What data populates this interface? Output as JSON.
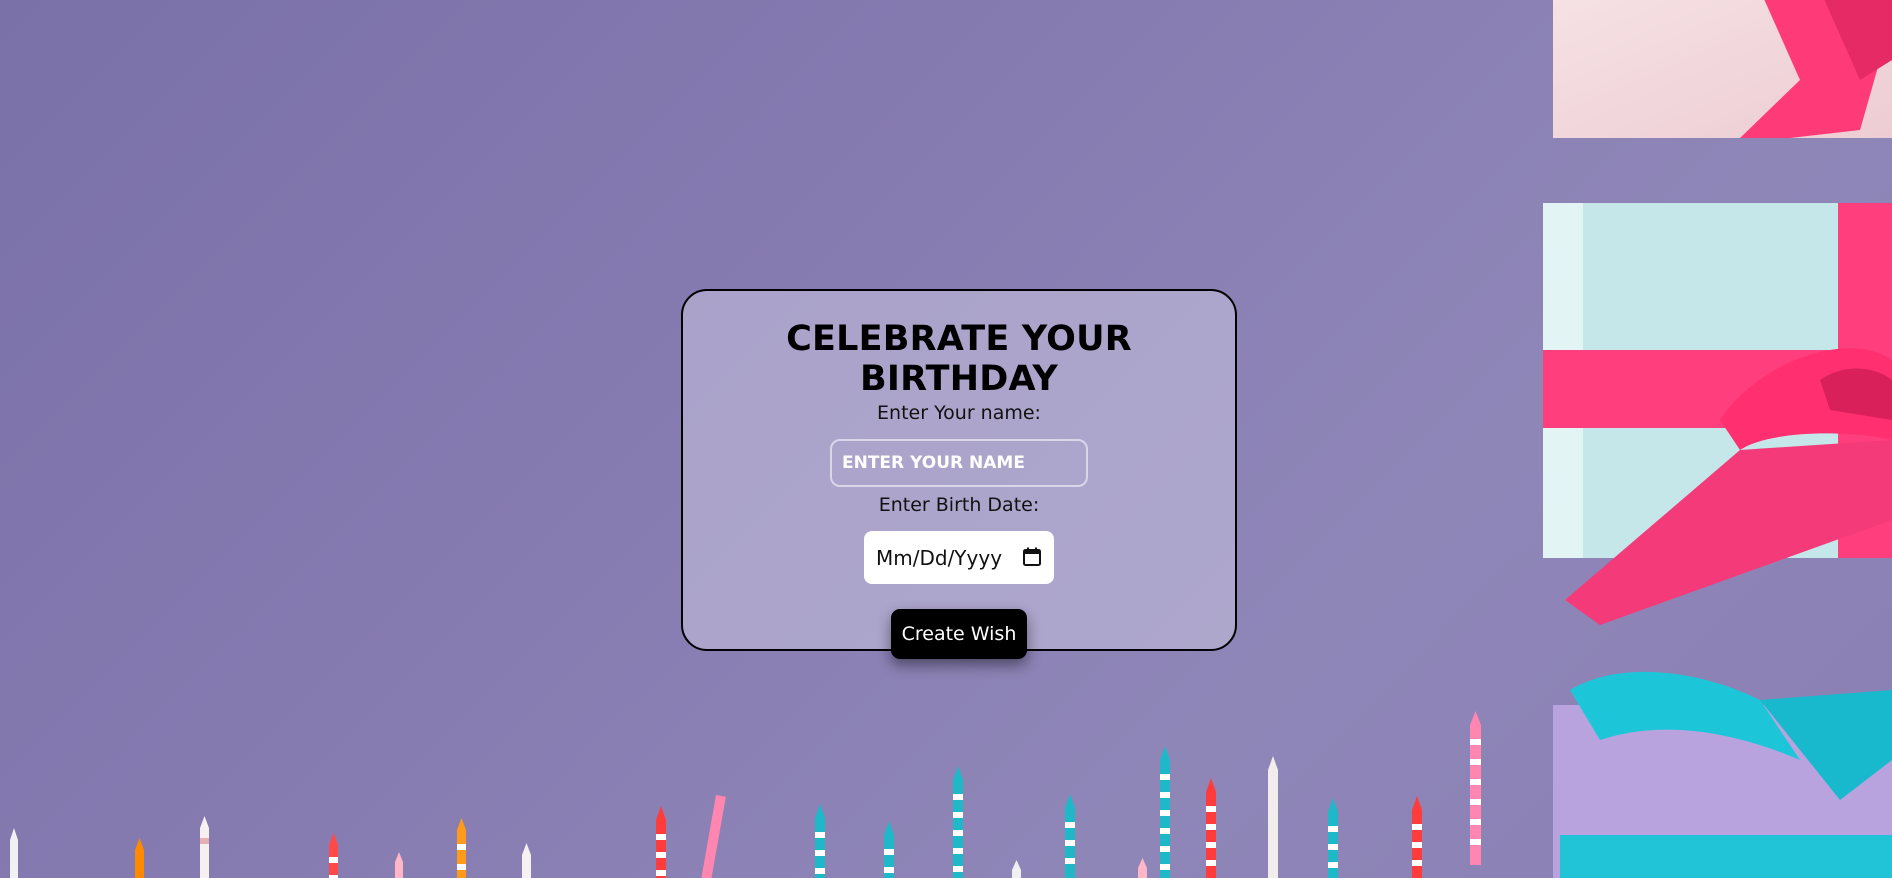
{
  "form": {
    "title": "CELEBRATE YOUR BIRTHDAY",
    "name_label": "Enter Your name:",
    "name_placeholder": "ENTER YOUR NAME",
    "date_label": "Enter Birth Date:",
    "date_placeholder": "Mm/Dd/Yyyy",
    "submit_label": "Create Wish"
  },
  "background": {
    "description_icons": [
      "gift-box-pink-icon",
      "gift-box-mint-icon",
      "gift-box-lavender-icon",
      "birthday-candles-icon"
    ],
    "colors": {
      "backdrop": "#857ab0",
      "ribbon_pink": "#ff3d7f",
      "ribbon_cyan": "#19c3d6",
      "card_border": "#000000",
      "button_bg": "#000000"
    }
  }
}
